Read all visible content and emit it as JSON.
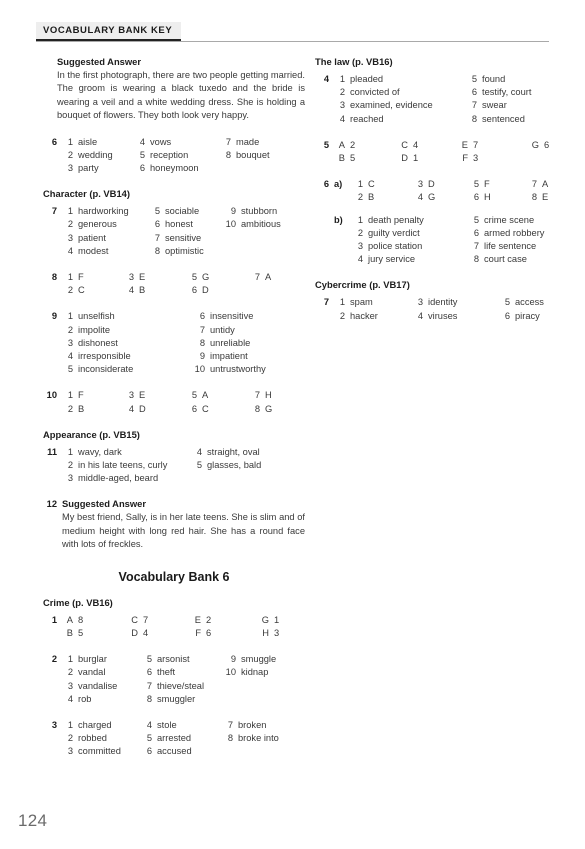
{
  "header": {
    "title": "VOCABULARY BANK KEY"
  },
  "page_number": "124",
  "bank_title": "Vocabulary Bank 6",
  "labels": {
    "suggested_answer": "Suggested Answer",
    "part_a": "a)",
    "part_b": "b)"
  },
  "sections": {
    "wedding_answer": {
      "heading": "Suggested Answer",
      "text": "In the first photograph, there are two people getting married. The groom is wearing a black tuxedo and the bride is wearing a veil and a white wedding dress. She is holding a bouquet of flowers. They both look very happy."
    },
    "character": {
      "heading": "Character (p. VB14)"
    },
    "appearance": {
      "heading": "Appearance (p. VB15)"
    },
    "crime": {
      "heading": "Crime (p. VB16)"
    },
    "law": {
      "heading": "The law (p. VB16)"
    },
    "cybercrime": {
      "heading": "Cybercrime (p. VB17)"
    }
  },
  "exercises": {
    "ex6_wedding": {
      "number": "6",
      "columns": [
        [
          {
            "k": "1",
            "v": "aisle"
          },
          {
            "k": "2",
            "v": "wedding"
          },
          {
            "k": "3",
            "v": "party"
          }
        ],
        [
          {
            "k": "4",
            "v": "vows"
          },
          {
            "k": "5",
            "v": "reception"
          },
          {
            "k": "6",
            "v": "honeymoon"
          }
        ],
        [
          {
            "k": "7",
            "v": "made"
          },
          {
            "k": "8",
            "v": "bouquet"
          }
        ]
      ]
    },
    "ex7_character": {
      "number": "7",
      "columns": [
        [
          {
            "k": "1",
            "v": "hardworking"
          },
          {
            "k": "2",
            "v": "generous"
          },
          {
            "k": "3",
            "v": "patient"
          },
          {
            "k": "4",
            "v": "modest"
          }
        ],
        [
          {
            "k": "5",
            "v": "sociable"
          },
          {
            "k": "6",
            "v": "honest"
          },
          {
            "k": "7",
            "v": "sensitive"
          },
          {
            "k": "8",
            "v": "optimistic"
          }
        ],
        [
          {
            "k": "9",
            "v": "stubborn"
          },
          {
            "k": "10",
            "v": "ambitious"
          }
        ]
      ]
    },
    "ex8_character": {
      "number": "8",
      "columns": [
        [
          {
            "k": "1",
            "v": "F"
          },
          {
            "k": "2",
            "v": "C"
          }
        ],
        [
          {
            "k": "3",
            "v": "E"
          },
          {
            "k": "4",
            "v": "B"
          }
        ],
        [
          {
            "k": "5",
            "v": "G"
          },
          {
            "k": "6",
            "v": "D"
          }
        ],
        [
          {
            "k": "7",
            "v": "A"
          }
        ]
      ]
    },
    "ex9_character": {
      "number": "9",
      "columns": [
        [
          {
            "k": "1",
            "v": "unselfish"
          },
          {
            "k": "2",
            "v": "impolite"
          },
          {
            "k": "3",
            "v": "dishonest"
          },
          {
            "k": "4",
            "v": "irresponsible"
          },
          {
            "k": "5",
            "v": "inconsiderate"
          }
        ],
        [
          {
            "k": "6",
            "v": "insensitive"
          },
          {
            "k": "7",
            "v": "untidy"
          },
          {
            "k": "8",
            "v": "unreliable"
          },
          {
            "k": "9",
            "v": "impatient"
          },
          {
            "k": "10",
            "v": "untrustworthy"
          }
        ]
      ]
    },
    "ex10_character": {
      "number": "10",
      "columns": [
        [
          {
            "k": "1",
            "v": "F"
          },
          {
            "k": "2",
            "v": "B"
          }
        ],
        [
          {
            "k": "3",
            "v": "E"
          },
          {
            "k": "4",
            "v": "D"
          }
        ],
        [
          {
            "k": "5",
            "v": "A"
          },
          {
            "k": "6",
            "v": "C"
          }
        ],
        [
          {
            "k": "7",
            "v": "H"
          },
          {
            "k": "8",
            "v": "G"
          }
        ]
      ]
    },
    "ex11_appearance": {
      "number": "11",
      "columns": [
        [
          {
            "k": "1",
            "v": "wavy, dark"
          },
          {
            "k": "2",
            "v": "in his late teens, curly"
          },
          {
            "k": "3",
            "v": "middle-aged, beard"
          }
        ],
        [
          {
            "k": "4",
            "v": "straight, oval"
          },
          {
            "k": "5",
            "v": "glasses, bald"
          }
        ]
      ]
    },
    "ex12_appearance": {
      "number": "12",
      "heading": "Suggested Answer",
      "text": "My best friend, Sally, is in her late teens. She is slim and of medium height with long red hair. She has a round face with lots of freckles."
    },
    "ex1_crime": {
      "number": "1",
      "columns": [
        [
          {
            "k": "A",
            "v": "8"
          },
          {
            "k": "B",
            "v": "5"
          }
        ],
        [
          {
            "k": "C",
            "v": "7"
          },
          {
            "k": "D",
            "v": "4"
          }
        ],
        [
          {
            "k": "E",
            "v": "2"
          },
          {
            "k": "F",
            "v": "6"
          }
        ],
        [
          {
            "k": "G",
            "v": "1"
          },
          {
            "k": "H",
            "v": "3"
          }
        ]
      ]
    },
    "ex2_crime": {
      "number": "2",
      "columns": [
        [
          {
            "k": "1",
            "v": "burglar"
          },
          {
            "k": "2",
            "v": "vandal"
          },
          {
            "k": "3",
            "v": "vandalise"
          },
          {
            "k": "4",
            "v": "rob"
          }
        ],
        [
          {
            "k": "5",
            "v": "arsonist"
          },
          {
            "k": "6",
            "v": "theft"
          },
          {
            "k": "7",
            "v": "thieve/steal"
          },
          {
            "k": "8",
            "v": "smuggler"
          }
        ],
        [
          {
            "k": "9",
            "v": "smuggle"
          },
          {
            "k": "10",
            "v": "kidnap"
          }
        ]
      ]
    },
    "ex3_crime": {
      "number": "3",
      "columns": [
        [
          {
            "k": "1",
            "v": "charged"
          },
          {
            "k": "2",
            "v": "robbed"
          },
          {
            "k": "3",
            "v": "committed"
          }
        ],
        [
          {
            "k": "4",
            "v": "stole"
          },
          {
            "k": "5",
            "v": "arrested"
          },
          {
            "k": "6",
            "v": "accused"
          }
        ],
        [
          {
            "k": "7",
            "v": "broken"
          },
          {
            "k": "8",
            "v": "broke into"
          }
        ]
      ]
    },
    "ex4_law": {
      "number": "4",
      "columns": [
        [
          {
            "k": "1",
            "v": "pleaded"
          },
          {
            "k": "2",
            "v": "convicted of"
          },
          {
            "k": "3",
            "v": "examined, evidence"
          },
          {
            "k": "4",
            "v": "reached"
          }
        ],
        [
          {
            "k": "5",
            "v": "found"
          },
          {
            "k": "6",
            "v": "testify, court"
          },
          {
            "k": "7",
            "v": "swear"
          },
          {
            "k": "8",
            "v": "sentenced"
          }
        ]
      ]
    },
    "ex5_law": {
      "number": "5",
      "columns": [
        [
          {
            "k": "A",
            "v": "2"
          },
          {
            "k": "B",
            "v": "5"
          }
        ],
        [
          {
            "k": "C",
            "v": "4"
          },
          {
            "k": "D",
            "v": "1"
          }
        ],
        [
          {
            "k": "E",
            "v": "7"
          },
          {
            "k": "F",
            "v": "3"
          }
        ],
        [
          {
            "k": "G",
            "v": "6"
          }
        ]
      ]
    },
    "ex6_law_a": {
      "number": "6",
      "label": "a)",
      "columns": [
        [
          {
            "k": "1",
            "v": "C"
          },
          {
            "k": "2",
            "v": "B"
          }
        ],
        [
          {
            "k": "3",
            "v": "D"
          },
          {
            "k": "4",
            "v": "G"
          }
        ],
        [
          {
            "k": "5",
            "v": "F"
          },
          {
            "k": "6",
            "v": "H"
          }
        ],
        [
          {
            "k": "7",
            "v": "A"
          },
          {
            "k": "8",
            "v": "E"
          }
        ]
      ]
    },
    "ex6_law_b": {
      "label": "b)",
      "columns": [
        [
          {
            "k": "1",
            "v": "death penalty"
          },
          {
            "k": "2",
            "v": "guilty verdict"
          },
          {
            "k": "3",
            "v": "police station"
          },
          {
            "k": "4",
            "v": "jury service"
          }
        ],
        [
          {
            "k": "5",
            "v": "crime scene"
          },
          {
            "k": "6",
            "v": "armed robbery"
          },
          {
            "k": "7",
            "v": "life sentence"
          },
          {
            "k": "8",
            "v": "court case"
          }
        ]
      ]
    },
    "ex7_cybercrime": {
      "number": "7",
      "columns": [
        [
          {
            "k": "1",
            "v": "spam"
          },
          {
            "k": "2",
            "v": "hacker"
          }
        ],
        [
          {
            "k": "3",
            "v": "identity"
          },
          {
            "k": "4",
            "v": "viruses"
          }
        ],
        [
          {
            "k": "5",
            "v": "access"
          },
          {
            "k": "6",
            "v": "piracy"
          }
        ]
      ]
    }
  }
}
